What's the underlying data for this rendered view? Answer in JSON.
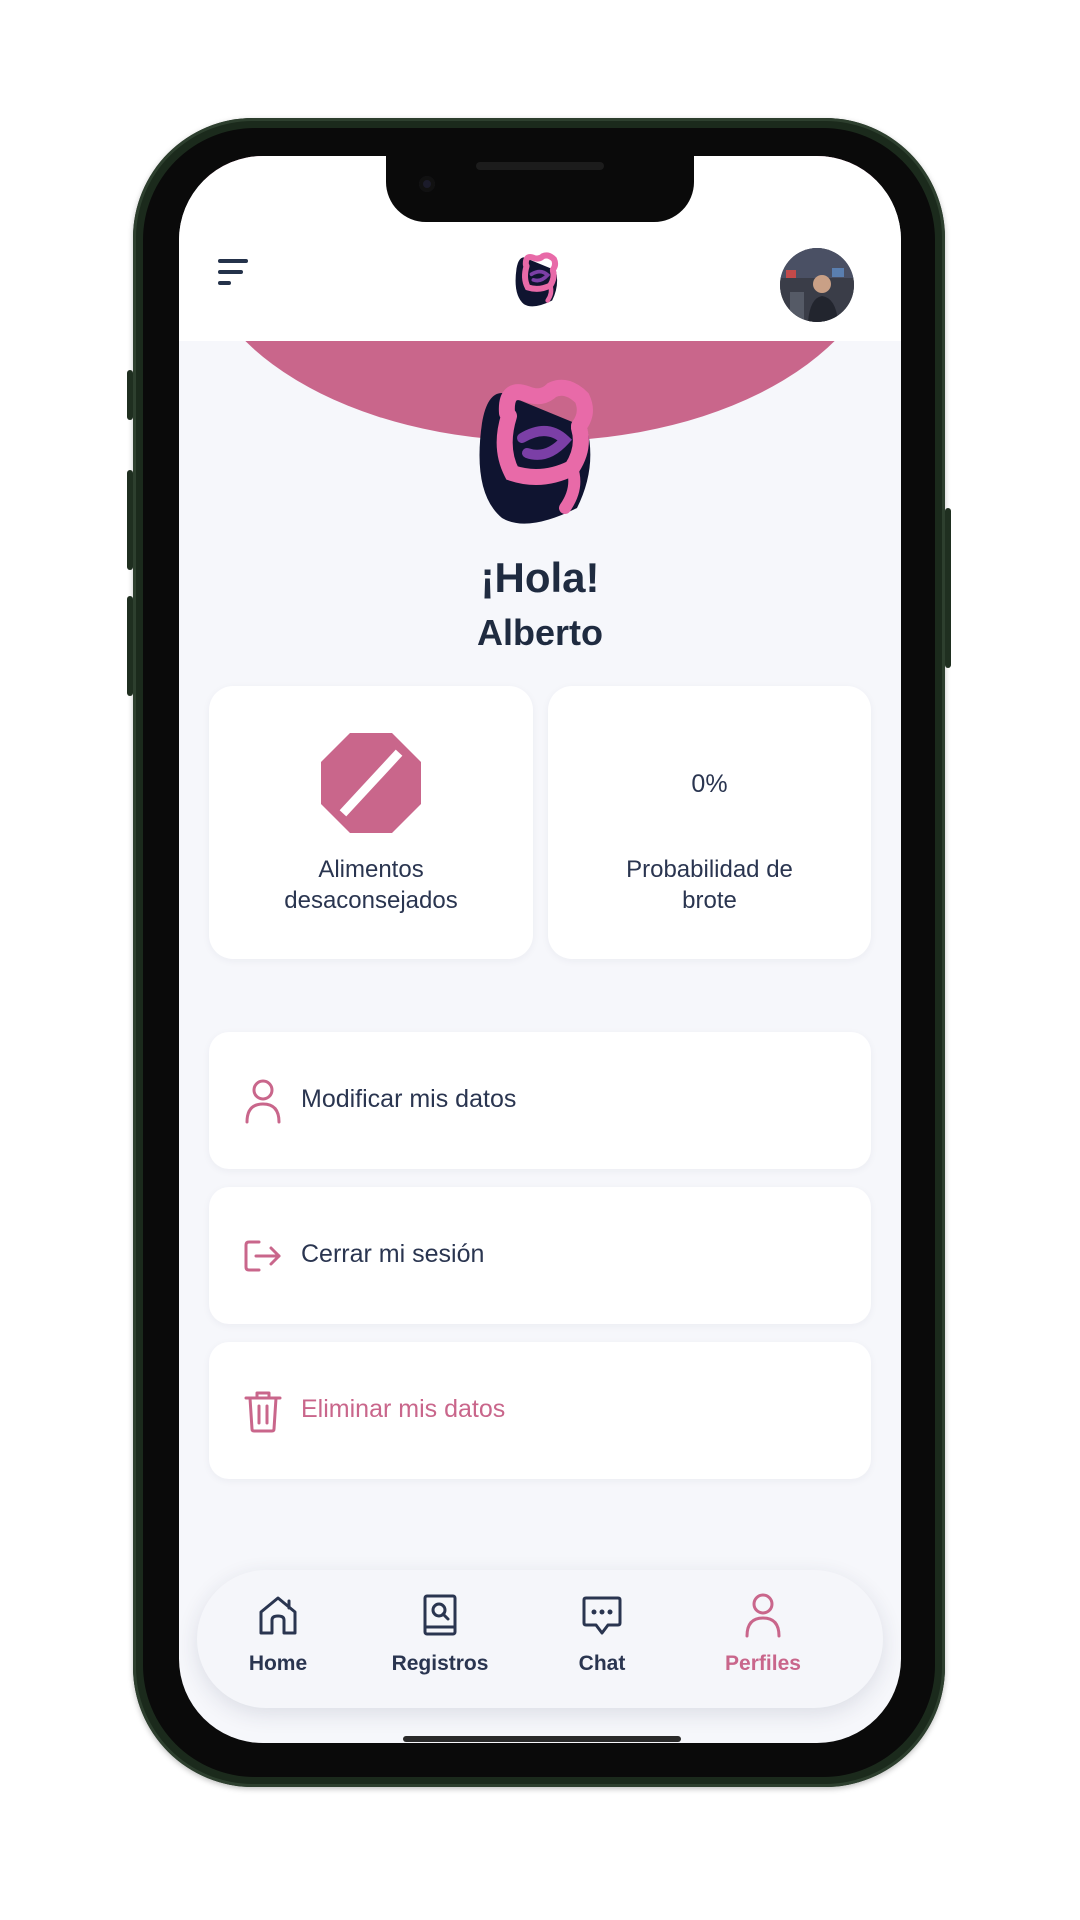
{
  "header": {
    "menu_icon": "hamburger-menu-icon",
    "logo_icon": "intestine-logo-icon",
    "avatar": "user-avatar-photo"
  },
  "hero": {
    "logo_icon": "intestine-logo-icon",
    "greeting": "¡Hola!",
    "name": "Alberto"
  },
  "stats": {
    "foods": {
      "icon": "prohibited-octagon-icon",
      "label_line1": "Alimentos",
      "label_line2": "desaconsejados"
    },
    "outbreak": {
      "value": "0%",
      "label_line1": "Probabilidad de",
      "label_line2": "brote"
    }
  },
  "actions": [
    {
      "icon": "user-icon",
      "label": "Modificar mis datos"
    },
    {
      "icon": "logout-icon",
      "label": "Cerrar mi sesión"
    },
    {
      "icon": "trash-icon",
      "label": "Eliminar mis datos"
    }
  ],
  "nav": [
    {
      "icon": "home-icon",
      "label": "Home",
      "active": false
    },
    {
      "icon": "records-icon",
      "label": "Registros",
      "active": false
    },
    {
      "icon": "chat-icon",
      "label": "Chat",
      "active": false
    },
    {
      "icon": "profile-icon",
      "label": "Perfiles",
      "active": true
    }
  ],
  "colors": {
    "accent": "#c9668b",
    "text": "#2a3550",
    "background": "#f6f7fb",
    "logo_dark": "#0f1430"
  }
}
